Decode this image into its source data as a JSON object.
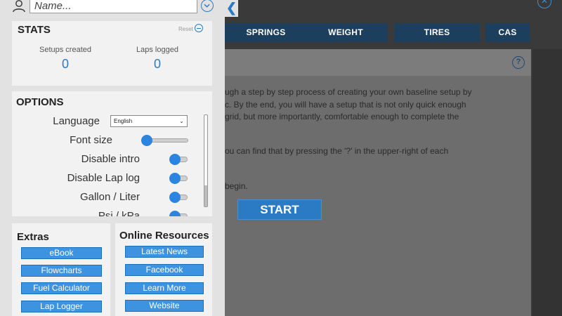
{
  "background": {
    "tabs": [
      {
        "label": "SPRINGS"
      },
      {
        "label": "WEIGHT"
      },
      {
        "label": "TIRES"
      },
      {
        "label": "CAS"
      }
    ],
    "help_icon": "?",
    "close_icon": "✕",
    "panel_lines": [
      "ugh a step by step process of creating your own baseline setup by",
      "c. By the end, you will have a setup that is not only quick enough",
      "grid, but more importantly, comfortable enough to complete the",
      "ou can find that by pressing the '?' in the upper-right of each",
      "begin."
    ],
    "start_label": "START"
  },
  "drawer": {
    "toggle_icon": "❮",
    "name_placeholder": "Name...",
    "stats": {
      "title": "STATS",
      "reset_label": "Reset",
      "setups_label": "Setups created",
      "setups_value": "0",
      "laps_label": "Laps logged",
      "laps_value": "0"
    },
    "options": {
      "title": "OPTIONS",
      "language_label": "Language",
      "language_value": "English",
      "font_size_label": "Font size",
      "font_size_level": 0,
      "disable_intro_label": "Disable intro",
      "disable_lap_log_label": "Disable Lap log",
      "gallon_liter_label": "Gallon / Liter",
      "partial_label": "Psi / kPa"
    },
    "extras": {
      "title": "Extras",
      "items": [
        "eBook",
        "Flowcharts",
        "Fuel Calculator",
        "Lap Logger"
      ]
    },
    "resources": {
      "title": "Online Resources",
      "items": [
        "Latest News",
        "Facebook",
        "Learn More",
        "Website"
      ]
    }
  },
  "colors": {
    "accent": "#2b7bc4",
    "tab_bg": "#1d3f5e",
    "drawer_bg": "#e2e2e2",
    "card_bg": "#f2f2f2"
  }
}
